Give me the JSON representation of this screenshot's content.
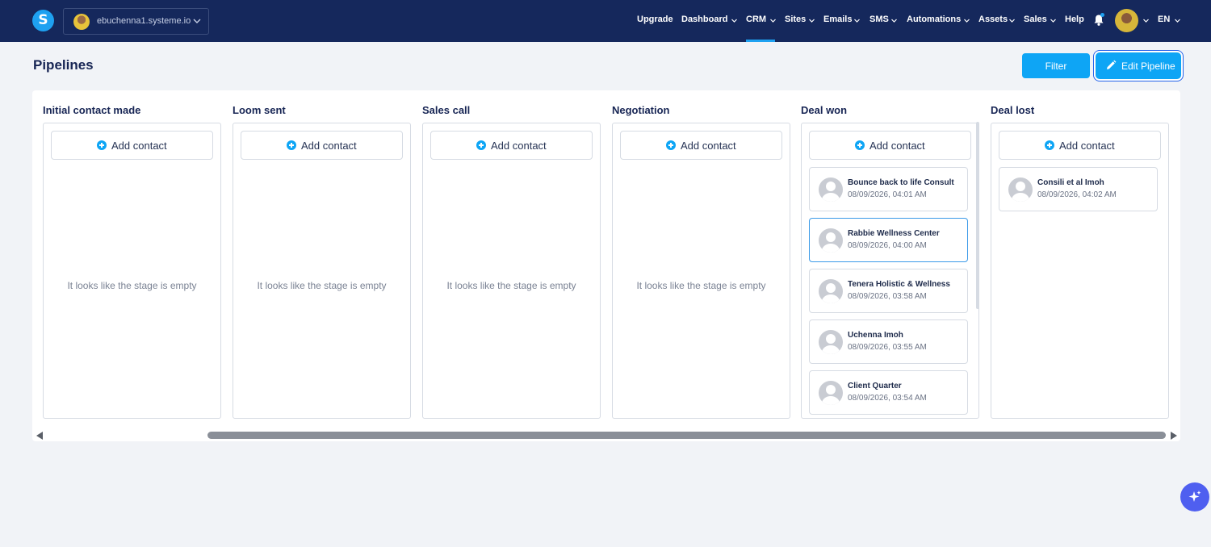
{
  "topbar": {
    "logo": "S",
    "domain": "ebuchenna1.systeme.io",
    "nav": [
      {
        "label": "Upgrade",
        "has_caret": false
      },
      {
        "label": "Dashboard",
        "has_caret": true
      },
      {
        "label": "CRM",
        "has_caret": true,
        "active": true
      },
      {
        "label": "Sites",
        "has_caret": true
      },
      {
        "label": "Emails",
        "has_caret": true
      },
      {
        "label": "SMS",
        "has_caret": true
      },
      {
        "label": "Automations",
        "has_caret": true
      },
      {
        "label": "Assets",
        "has_caret": true
      },
      {
        "label": "Sales",
        "has_caret": true
      },
      {
        "label": "Help",
        "has_caret": false
      }
    ],
    "language": "EN"
  },
  "page": {
    "title": "Pipelines",
    "filter_label": "Filter",
    "edit_label": "Edit Pipeline"
  },
  "stages": [
    {
      "title": "Initial contact made",
      "add_label": "Add contact",
      "empty_text": "It looks like the stage is empty",
      "cards": []
    },
    {
      "title": "Loom sent",
      "add_label": "Add contact",
      "empty_text": "It looks like the stage is empty",
      "cards": []
    },
    {
      "title": "Sales call",
      "add_label": "Add contact",
      "empty_text": "It looks like the stage is empty",
      "cards": []
    },
    {
      "title": "Negotiation",
      "add_label": "Add contact",
      "empty_text": "It looks like the stage is empty",
      "cards": []
    },
    {
      "title": "Deal won",
      "add_label": "Add contact",
      "empty_text": "",
      "cards": [
        {
          "name": "Bounce back to life Consult",
          "date": "08/09/2026, 04:01 AM"
        },
        {
          "name": "Rabbie Wellness Center",
          "date": "08/09/2026, 04:00 AM"
        },
        {
          "name": "Tenera Holistic & Wellness",
          "date": "08/09/2026, 03:58 AM"
        },
        {
          "name": "Uchenna Imoh",
          "date": "08/09/2026, 03:55 AM"
        },
        {
          "name": "Client Quarter",
          "date": "08/09/2026, 03:54 AM"
        }
      ]
    },
    {
      "title": "Deal lost",
      "add_label": "Add contact",
      "empty_text": "",
      "cards": [
        {
          "name": "Consili et al Imoh",
          "date": "08/09/2026, 04:02 AM"
        }
      ]
    }
  ],
  "icons": {
    "brand": "#1ea1f1",
    "topbar_bg": "#15285c",
    "button": "#0ea5f5"
  }
}
